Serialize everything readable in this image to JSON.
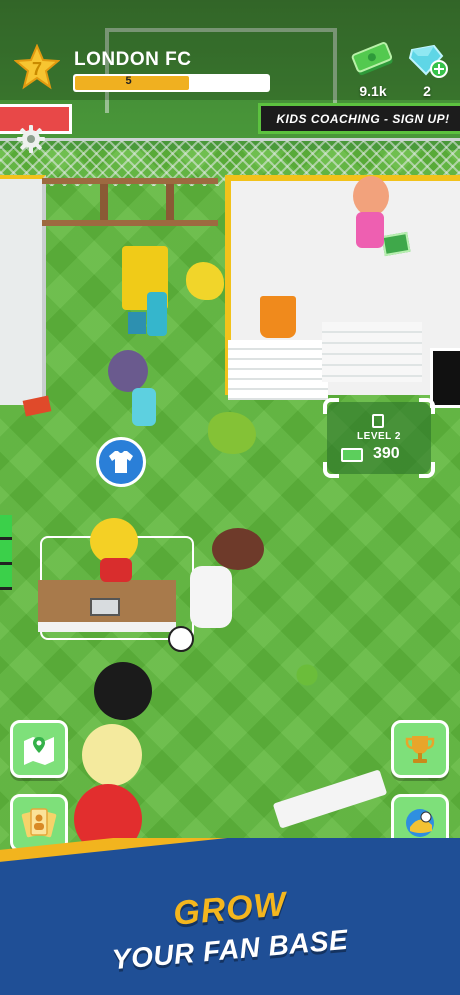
{
  "hud": {
    "level": "7",
    "club_name": "LONDON FC",
    "xp_value": "5",
    "xp_fraction": 0.6,
    "cash": "9.1k",
    "gems": "2"
  },
  "signs": {
    "right": "KIDS COACHING - SIGN UP!"
  },
  "upgrade": {
    "level_label": "LEVEL 2",
    "cost": "390"
  },
  "side_buttons": {
    "left": [
      "map-icon",
      "staff-cards-icon"
    ],
    "right": [
      "trophy-icon",
      "football-icon"
    ]
  },
  "banner": {
    "line1": "GROW",
    "line2": "YOUR FAN BASE"
  },
  "colors": {
    "accent_yellow": "#f2b41e",
    "banner_blue": "#1f4f96",
    "button_green": "#7ee07a"
  }
}
